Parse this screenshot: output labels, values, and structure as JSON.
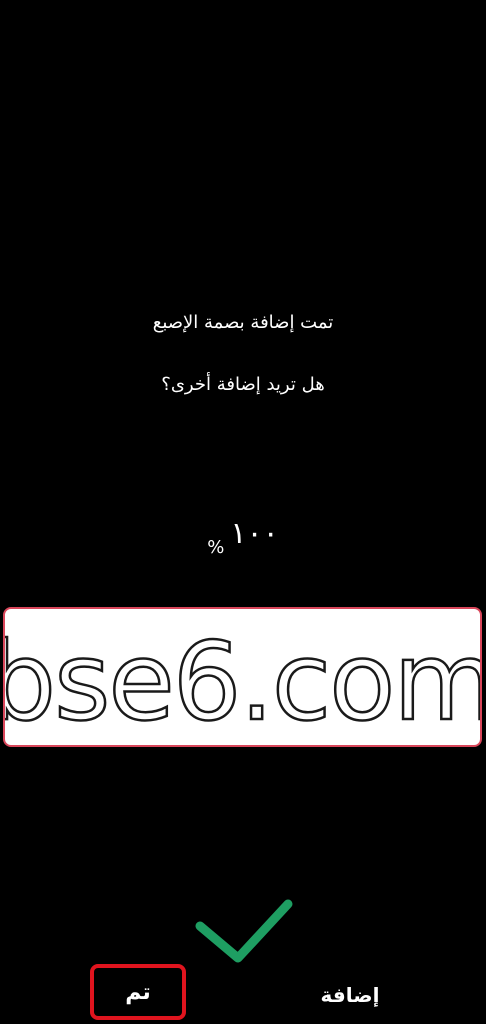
{
  "message": {
    "title": "تمت إضافة بصمة الإصبع",
    "question": "هل تريد إضافة أخرى؟"
  },
  "progress": {
    "value": "١٠٠",
    "unit": "%"
  },
  "watermark": {
    "text": "bse6.com"
  },
  "icons": {
    "success": "checkmark-icon"
  },
  "actions": {
    "done_label": "تم",
    "add_label": "إضافة"
  },
  "colors": {
    "background": "#000000",
    "text": "#ffffff",
    "check": "#1e9e62",
    "done_highlight": "#e0141e",
    "watermark_border": "#d9465a"
  }
}
